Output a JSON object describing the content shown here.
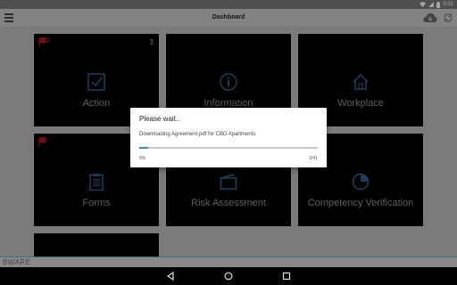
{
  "status": {
    "time": "5:01"
  },
  "appbar": {
    "title": "Dashboard"
  },
  "tiles": [
    {
      "label": "Action",
      "badge": "3",
      "flag_count": "2"
    },
    {
      "label": "Information"
    },
    {
      "label": "Workplace"
    },
    {
      "label": "Forms"
    },
    {
      "label": "Risk Assessment"
    },
    {
      "label": "Competency Verification"
    }
  ],
  "footer": {
    "brand": "BWARE"
  },
  "dialog": {
    "title": "Please wait..",
    "message": "Downloading Agreement.pdf for CBD Apartments",
    "percent_label": "5%",
    "count_label": "2/41",
    "progress": 0.05
  },
  "colors": {
    "tile_bg": "#000000",
    "progress": "#3a8f99",
    "flag": "#b0151b"
  },
  "icons": [
    "menu-icon",
    "cloud-download-icon",
    "sync-icon",
    "checkbox-icon",
    "info-icon",
    "home-icon",
    "clipboard-icon",
    "clapperboard-icon",
    "pie-chart-icon",
    "flag-icon",
    "back-icon",
    "home-nav-icon",
    "recents-icon"
  ]
}
